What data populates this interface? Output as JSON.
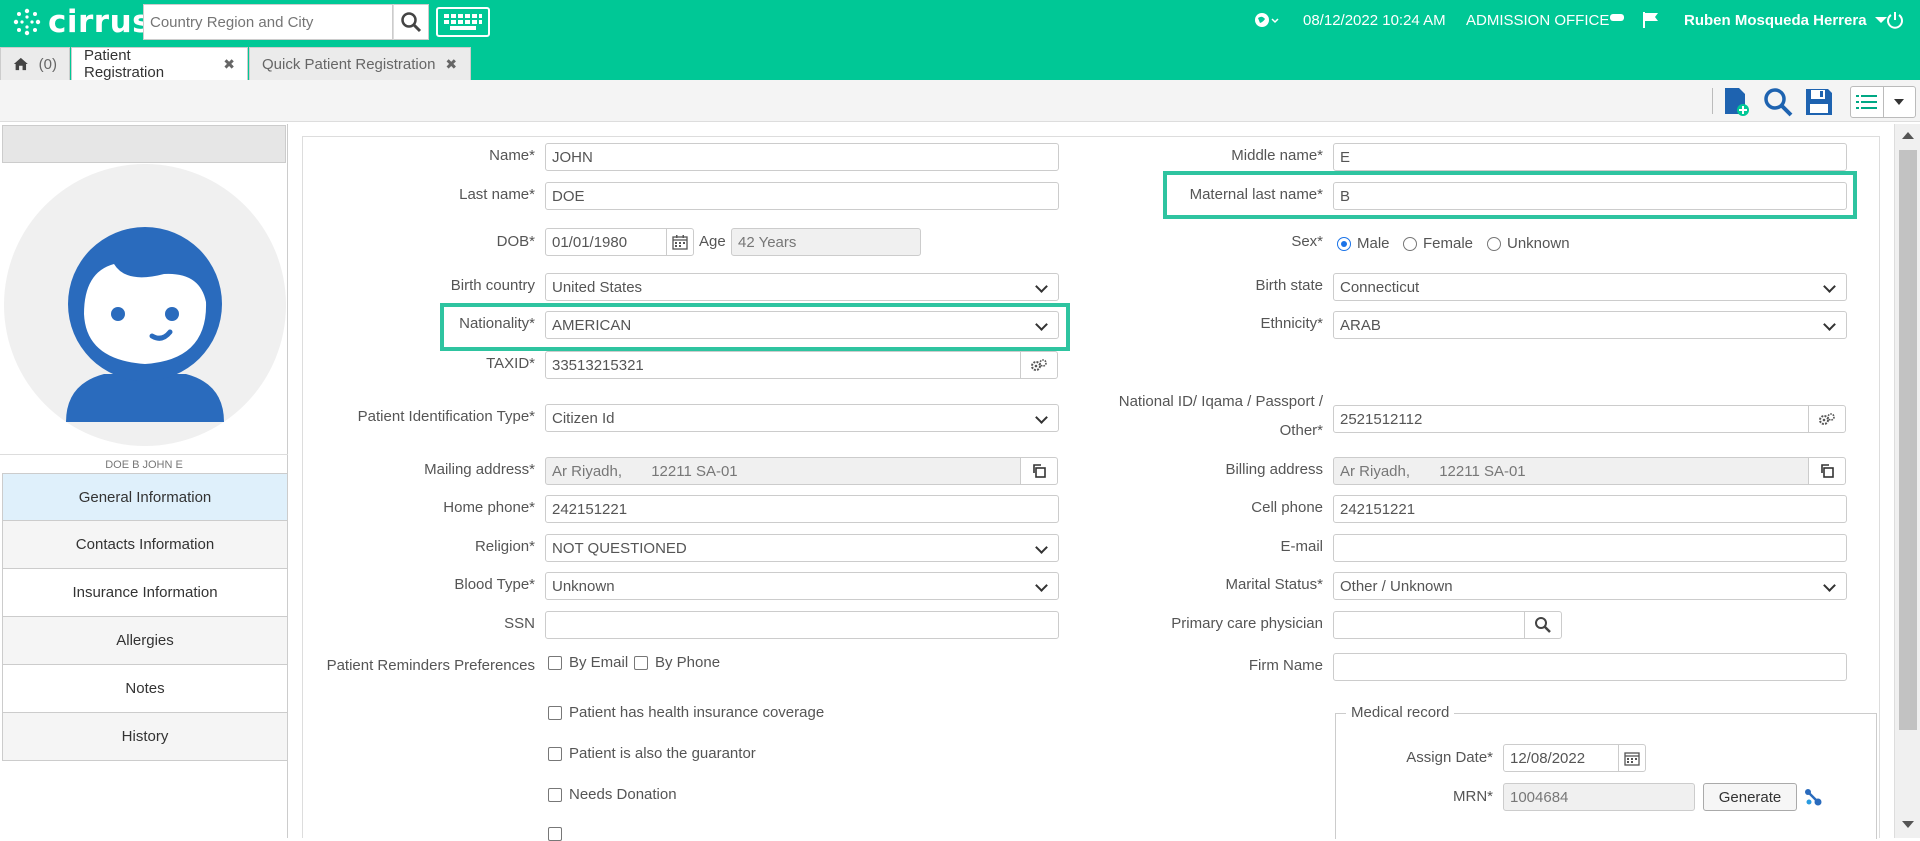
{
  "app": {
    "name": "cirrus"
  },
  "header": {
    "search_placeholder": "Country Region and City",
    "datetime": "08/12/2022 10:24 AM",
    "office": "ADMISSION OFFICE",
    "user": "Ruben Mosqueda Herrera",
    "brand_color": "#00c896"
  },
  "tabs": {
    "home_count": "(0)",
    "items": [
      {
        "label": "Patient Registration",
        "active": true
      },
      {
        "label": "Quick Patient Registration",
        "active": false
      }
    ]
  },
  "sidebar": {
    "patient_name": "DOE B JOHN E",
    "items": [
      {
        "label": "General Information"
      },
      {
        "label": "Contacts Information"
      },
      {
        "label": "Insurance Information"
      },
      {
        "label": "Allergies"
      },
      {
        "label": "Notes"
      },
      {
        "label": "History"
      }
    ]
  },
  "form": {
    "name": {
      "label": "Name*",
      "value": "JOHN"
    },
    "middle_name": {
      "label": "Middle name*",
      "value": "E"
    },
    "last_name": {
      "label": "Last name*",
      "value": "DOE"
    },
    "maternal_last_name": {
      "label": "Maternal last name*",
      "value": "B"
    },
    "dob": {
      "label": "DOB*",
      "value": "01/01/1980"
    },
    "age": {
      "label": "Age",
      "value": "42 Years"
    },
    "sex": {
      "label": "Sex*",
      "options": [
        "Male",
        "Female",
        "Unknown"
      ],
      "selected": "Male"
    },
    "birth_country": {
      "label": "Birth country",
      "value": "United States"
    },
    "birth_state": {
      "label": "Birth state",
      "value": "Connecticut"
    },
    "nationality": {
      "label": "Nationality*",
      "value": "AMERICAN"
    },
    "ethnicity": {
      "label": "Ethnicity*",
      "value": "ARAB"
    },
    "taxid": {
      "label": "TAXID*",
      "value": "33513215321"
    },
    "id_type": {
      "label": "Patient Identification Type*",
      "value": "Citizen Id"
    },
    "national_id": {
      "label_line1": "National ID/ Iqama / Passport /",
      "label_line2": "Other*",
      "value": "2521512112"
    },
    "mailing_address": {
      "label": "Mailing address*",
      "value": "Ar Riyadh,       12211 SA-01"
    },
    "billing_address": {
      "label": "Billing address",
      "value": "Ar Riyadh,       12211 SA-01"
    },
    "home_phone": {
      "label": "Home phone*",
      "value": "242151221"
    },
    "cell_phone": {
      "label": "Cell phone",
      "value": "242151221"
    },
    "religion": {
      "label": "Religion*",
      "value": "NOT QUESTIONED"
    },
    "email": {
      "label": "E-mail",
      "value": ""
    },
    "blood_type": {
      "label": "Blood Type*",
      "value": "Unknown"
    },
    "marital_status": {
      "label": "Marital Status*",
      "value": "Other / Unknown"
    },
    "ssn": {
      "label": "SSN",
      "value": ""
    },
    "pcp": {
      "label": "Primary care physician",
      "value": ""
    },
    "reminders": {
      "label": "Patient Reminders Preferences",
      "by_email": "By Email",
      "by_phone": "By Phone"
    },
    "firm_name": {
      "label": "Firm Name",
      "value": ""
    },
    "chk_insurance": "Patient has health insurance coverage",
    "chk_guarantor": "Patient is also the guarantor",
    "chk_donation": "Needs Donation",
    "medical_record": {
      "legend": "Medical record",
      "assign_date_label": "Assign Date*",
      "assign_date": "12/08/2022",
      "mrn_label": "MRN*",
      "mrn": "1004684",
      "generate": "Generate"
    }
  }
}
